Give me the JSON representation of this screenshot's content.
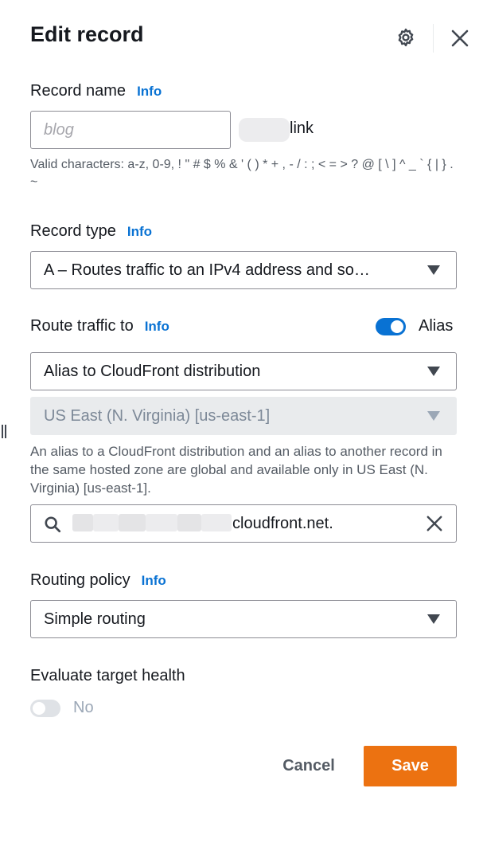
{
  "header": {
    "title": "Edit record",
    "settings_icon": "gear-icon",
    "close_icon": "close-icon"
  },
  "record_name": {
    "label": "Record name",
    "info": "Info",
    "placeholder": "blog",
    "value": "",
    "domain_suffix": "link",
    "hint": "Valid characters: a-z, 0-9, ! \" # $ % & ' ( ) * + , - / : ; < = > ? @ [ \\ ] ^ _ ` { | } . ~"
  },
  "record_type": {
    "label": "Record type",
    "info": "Info",
    "selected": "A – Routes traffic to an IPv4 address and so…"
  },
  "route_traffic": {
    "label": "Route traffic to",
    "info": "Info",
    "alias_label": "Alias",
    "alias_on": true,
    "endpoint_selected": "Alias to CloudFront distribution",
    "region_selected": "US East (N. Virginia) [us-east-1]",
    "region_hint": "An alias to a CloudFront distribution and an alias to another record in the same hosted zone are global and available only in US East (N. Virginia) [us-east-1].",
    "distribution_value": "cloudfront.net."
  },
  "routing_policy": {
    "label": "Routing policy",
    "info": "Info",
    "selected": "Simple routing"
  },
  "target_health": {
    "label": "Evaluate target health",
    "toggle_label": "No",
    "on": false
  },
  "footer": {
    "cancel_label": "Cancel",
    "save_label": "Save"
  },
  "colors": {
    "accent": "#0972d3",
    "primary_button": "#ec7211",
    "text": "#16191f",
    "muted_text": "#545b64"
  }
}
